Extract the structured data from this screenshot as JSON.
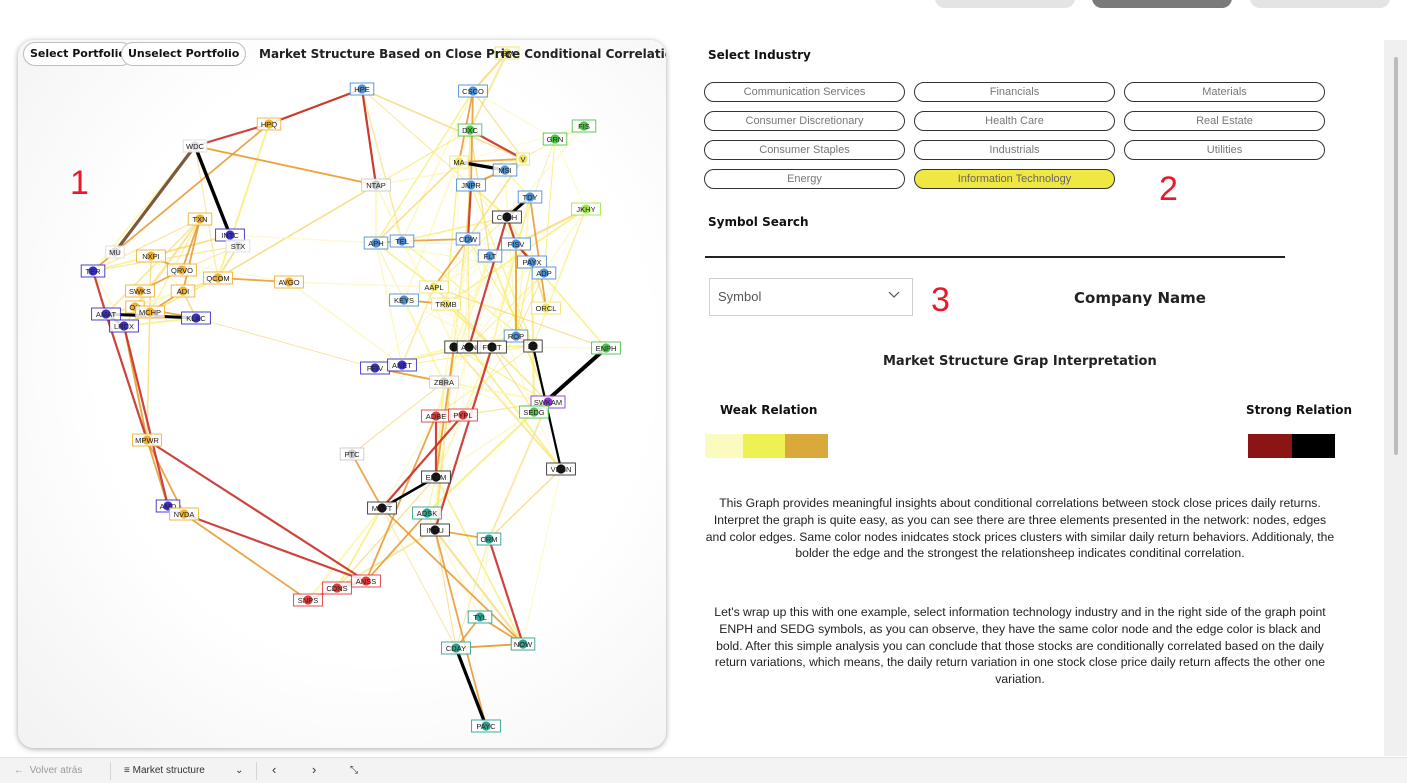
{
  "graph": {
    "select_portfolio": "Select Portfolio",
    "unselect_portfolio": "Unselect Portfolio",
    "title": "Market Structure Based on Close Price Conditional Correlation",
    "nodes": [
      {
        "id": "HPE",
        "c": "#4f8fd0"
      },
      {
        "id": "IBM",
        "c": "#f0e36a"
      },
      {
        "id": "CSCO",
        "c": "#4f8fd0"
      },
      {
        "id": "HPQ",
        "c": "#f0b030"
      },
      {
        "id": "DXC",
        "c": "#4cc44c"
      },
      {
        "id": "GRN",
        "c": "#4cc44c"
      },
      {
        "id": "FIS",
        "c": "#4cc44c"
      },
      {
        "id": "V",
        "c": "#f0e36a"
      },
      {
        "id": "MA",
        "c": "#f0e36a"
      },
      {
        "id": "MSI",
        "c": "#4f8fd0"
      },
      {
        "id": "WDC",
        "c": "#dddddd"
      },
      {
        "id": "NTAP",
        "c": "#c9c9c9"
      },
      {
        "id": "JNPR",
        "c": "#4f8fd0"
      },
      {
        "id": "TDY",
        "c": "#4f8fd0"
      },
      {
        "id": "JKHY",
        "c": "#9ee64c"
      },
      {
        "id": "CTSH",
        "c": "#111111"
      },
      {
        "id": "TXN",
        "c": "#f0b030"
      },
      {
        "id": "INTC",
        "c": "#3b2fc0"
      },
      {
        "id": "STX",
        "c": "#dddddd"
      },
      {
        "id": "APH",
        "c": "#4f8fd0"
      },
      {
        "id": "TEL",
        "c": "#4f8fd0"
      },
      {
        "id": "CDW",
        "c": "#4f8fd0"
      },
      {
        "id": "FISV",
        "c": "#4f8fd0"
      },
      {
        "id": "FLT",
        "c": "#4f8fd0"
      },
      {
        "id": "PAYX",
        "c": "#4f8fd0"
      },
      {
        "id": "ADP",
        "c": "#4f8fd0"
      },
      {
        "id": "MU",
        "c": "#dddddd"
      },
      {
        "id": "NXPI",
        "c": "#f0b030"
      },
      {
        "id": "TER",
        "c": "#3b2fc0"
      },
      {
        "id": "QRVO",
        "c": "#f0b030"
      },
      {
        "id": "QCOM",
        "c": "#f0b030"
      },
      {
        "id": "AVGO",
        "c": "#f0b030"
      },
      {
        "id": "SWKS",
        "c": "#f0b030"
      },
      {
        "id": "ADI",
        "c": "#f0b030"
      },
      {
        "id": "AAPL",
        "c": "#f0e36a"
      },
      {
        "id": "KEYS",
        "c": "#4f8fd0"
      },
      {
        "id": "TRMB",
        "c": "#f0e36a"
      },
      {
        "id": "ON",
        "c": "#f0b030"
      },
      {
        "id": "MCHP",
        "c": "#f0b030"
      },
      {
        "id": "AMAT",
        "c": "#3b2fc0"
      },
      {
        "id": "KLAC",
        "c": "#3b2fc0"
      },
      {
        "id": "ORCL",
        "c": "#f0e36a"
      },
      {
        "id": "LRCX",
        "c": "#3b2fc0"
      },
      {
        "id": "ENPH",
        "c": "#4cc44c"
      },
      {
        "id": "ROP",
        "c": "#4f8fd0"
      },
      {
        "id": "IT",
        "c": "#111111"
      },
      {
        "id": "ACN",
        "c": "#111111"
      },
      {
        "id": "FTNT",
        "c": "#111111"
      },
      {
        "id": "BR",
        "c": "#111111"
      },
      {
        "id": "FFIV",
        "c": "#3b2fc0"
      },
      {
        "id": "ANET",
        "c": "#3b2fc0"
      },
      {
        "id": "ZBRA",
        "c": "#c9c9c9"
      },
      {
        "id": "SWKAM",
        "c": "#8b3ad0"
      },
      {
        "id": "ADBE",
        "c": "#e03b3b"
      },
      {
        "id": "PYPL",
        "c": "#e03b3b"
      },
      {
        "id": "SEDG",
        "c": "#4cc44c"
      },
      {
        "id": "MPWR",
        "c": "#f0b030"
      },
      {
        "id": "PTC",
        "c": "#c9c9c9"
      },
      {
        "id": "EPAM",
        "c": "#111111"
      },
      {
        "id": "VRSN",
        "c": "#111111"
      },
      {
        "id": "AMD",
        "c": "#3b2fc0"
      },
      {
        "id": "NVDA",
        "c": "#f0b030"
      },
      {
        "id": "MSFT",
        "c": "#111111"
      },
      {
        "id": "ADSK",
        "c": "#2f9f8f"
      },
      {
        "id": "INTU",
        "c": "#111111"
      },
      {
        "id": "CRM",
        "c": "#2f9f8f"
      },
      {
        "id": "ANSS",
        "c": "#e03b3b"
      },
      {
        "id": "CDNS",
        "c": "#e03b3b"
      },
      {
        "id": "SNPS",
        "c": "#e03b3b"
      },
      {
        "id": "TYL",
        "c": "#2f9f8f"
      },
      {
        "id": "NOW",
        "c": "#2f9f8f"
      },
      {
        "id": "CDAY",
        "c": "#2f9f8f"
      },
      {
        "id": "PAYC",
        "c": "#2f9f8f"
      }
    ]
  },
  "markers": {
    "m1": "1",
    "m2": "2",
    "m3": "3"
  },
  "industry": {
    "label": "Select Industry",
    "items": [
      "Communication Services",
      "Financials",
      "Materials",
      "Consumer Discretionary",
      "Health Care",
      "Real Estate",
      "Consumer Staples",
      "Industrials",
      "Utilities",
      "Energy",
      "Information Technology"
    ],
    "selected": "Information Technology",
    "selected_color": "#efe843"
  },
  "search": {
    "label": "Symbol Search",
    "symbol_placeholder": "Symbol",
    "company_label": "Company Name"
  },
  "interpretation": {
    "title": "Market Structure Grap Interpretation",
    "weak_label": "Weak Relation",
    "strong_label": "Strong Relation",
    "weak_colors": [
      "#fbfbbf",
      "#eef152",
      "#d9a93b"
    ],
    "strong_colors": [
      "#8b1414",
      "#000000"
    ],
    "paragraph1": "This Graph provides meaningful insights about conditional correlations between stock close prices daily returns. Interpret the graph is quite easy, as you can see there are three elements presented in the network: nodes, edges and color edges. Same color nodes inidcates stock prices clusters with similar daily return behaviors. Additionaly, the bolder the edge and the strongest the relationsheep indicates conditinal correlation.",
    "paragraph2": "Let's wrap up this with one example, select information technology industry and in the right side of the graph point ENPH and SEDG symbols, as you can observe, they have the same color node and the edge color is black and bold. After this simple analysis you can conclude that those stocks are conditionally correlated based on the daily return variations, which means, the daily return variation in one stock close price daily return affects the other one variation."
  },
  "bottom_bar": {
    "back": "Volver atrás",
    "page_name": "Market structure"
  }
}
